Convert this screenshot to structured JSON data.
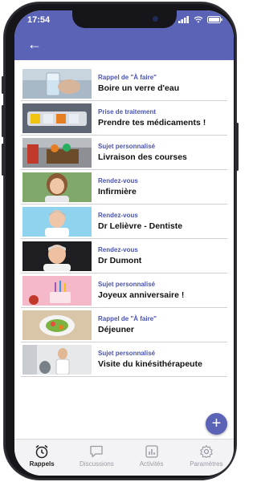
{
  "status_bar": {
    "time": "17:54"
  },
  "reminders": [
    {
      "category": "Rappel de \"À faire\"",
      "title": "Boire un verre d'eau",
      "image": "glass-of-water-photo"
    },
    {
      "category": "Prise de traitement",
      "title": "Prendre tes médicaments !",
      "image": "pill-organizer-photo"
    },
    {
      "category": "Sujet personnalisé",
      "title": "Livraison des courses",
      "image": "grocery-delivery-photo"
    },
    {
      "category": "Rendez-vous",
      "title": "Infirmière",
      "image": "nurse-portrait-photo"
    },
    {
      "category": "Rendez-vous",
      "title": "Dr Lelièvre - Dentiste",
      "image": "dentist-portrait-photo"
    },
    {
      "category": "Rendez-vous",
      "title": "Dr Dumont",
      "image": "doctor-portrait-photo"
    },
    {
      "category": "Sujet personnalisé",
      "title": "Joyeux anniversaire !",
      "image": "birthday-cake-photo"
    },
    {
      "category": "Rappel de \"À faire\"",
      "title": "Déjeuner",
      "image": "lunch-plate-photo"
    },
    {
      "category": "Sujet personnalisé",
      "title": "Visite du kinésithérapeute",
      "image": "physiotherapist-photo"
    }
  ],
  "tabs": [
    {
      "label": "Rappels",
      "icon": "alarm-clock-icon",
      "active": true
    },
    {
      "label": "Discussions",
      "icon": "chat-bubble-icon",
      "active": false
    },
    {
      "label": "Activités",
      "icon": "bar-chart-icon",
      "active": false
    },
    {
      "label": "Paramètres",
      "icon": "gear-icon",
      "active": false
    }
  ],
  "colors": {
    "accent": "#5b63b7",
    "category_text": "#4a54b0"
  }
}
